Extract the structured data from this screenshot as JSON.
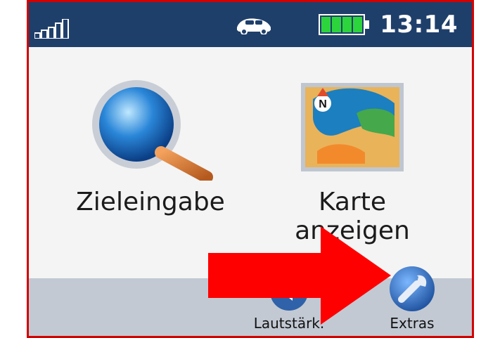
{
  "status_bar": {
    "time": "13:14",
    "signal_icon": "signal-strength-icon",
    "vehicle_icon": "car-icon",
    "battery_icon": "battery-full-icon"
  },
  "tiles": [
    {
      "label": "Zieleingabe",
      "icon": "magnifying-glass-icon"
    },
    {
      "label": "Karte anzeigen",
      "icon": "map-icon"
    }
  ],
  "bottom_bar": [
    {
      "label": "Lautstärk.",
      "icon": "speaker-icon"
    },
    {
      "label": "Extras",
      "icon": "wrench-icon"
    }
  ],
  "colors": {
    "status_bar": "#1f3f6b",
    "content_bg": "#f4f4f4",
    "bottom_bar": "#c2c9d3",
    "frame_border": "#d30000",
    "arrow": "#ff0000"
  }
}
